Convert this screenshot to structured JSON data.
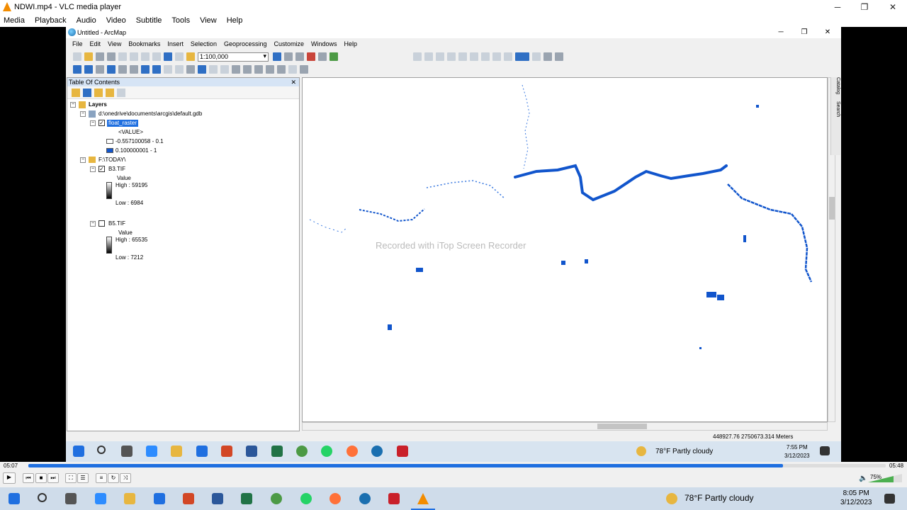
{
  "vlc": {
    "title": "NDWI.mp4 - VLC media player",
    "menu": [
      "Media",
      "Playback",
      "Audio",
      "Video",
      "Subtitle",
      "Tools",
      "View",
      "Help"
    ],
    "time_elapsed": "05:07",
    "time_total": "05:48",
    "progress": 0.88,
    "volume": "75%"
  },
  "arcmap": {
    "title": "Untitled - ArcMap",
    "menu": [
      "File",
      "Edit",
      "View",
      "Bookmarks",
      "Insert",
      "Selection",
      "Geoprocessing",
      "Customize",
      "Windows",
      "Help"
    ],
    "scale": "1:100,000",
    "toc": {
      "title": "Table Of Contents",
      "layers_label": "Layers",
      "gdb": "d:\\onedrive\\documents\\arcgis\\default.gdb",
      "float_raster": "float_raster",
      "value_header": "<VALUE>",
      "class1": "-0.557100058 - 0.1",
      "class2": "0.100000001 - 1",
      "folder": "F:\\TODAY\\",
      "b3": "B3.TIF",
      "b3_value": "Value",
      "b3_high": "High : 59195",
      "b3_low": "Low : 6984",
      "b5": "B5.TIF",
      "b5_value": "Value",
      "b5_high": "High : 65535",
      "b5_low": "Low : 7212"
    },
    "watermark": "Recorded with iTop Screen Recorder",
    "coords": "448927.76  2750673.314 Meters",
    "side_tabs": [
      "Catalog",
      "Search"
    ]
  },
  "inner_taskbar": {
    "weather": "78°F  Partly cloudy",
    "time": "7:55 PM",
    "date": "3/12/2023"
  },
  "os_taskbar": {
    "weather": "78°F  Partly cloudy",
    "time": "8:05 PM",
    "date": "3/12/2023"
  },
  "colors": {
    "water": "#1155cc",
    "accent": "#1f6fe0"
  }
}
